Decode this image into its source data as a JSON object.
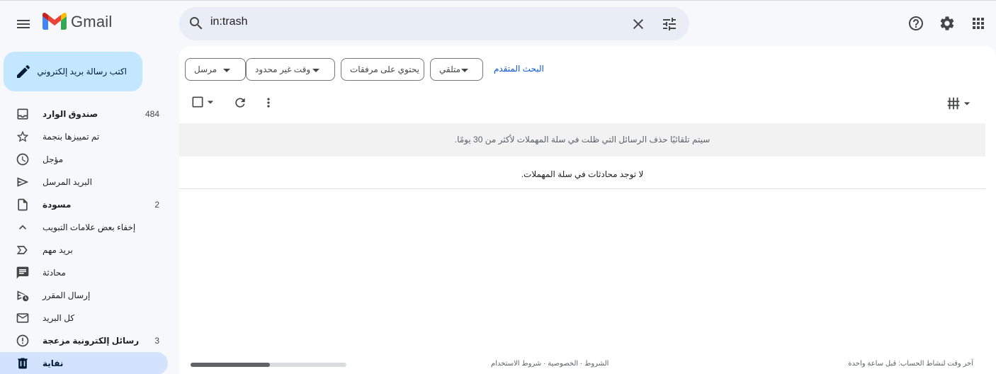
{
  "app": {
    "name": "Gmail"
  },
  "search": {
    "query": "in:trash"
  },
  "compose": {
    "label": "اكتب رسالة بريد إلكتروني"
  },
  "sidebar": {
    "items": [
      {
        "label": "صندوق الوارد",
        "count": "484",
        "icon": "inbox-icon"
      },
      {
        "label": "تم تمييزها بنجمة",
        "count": "",
        "icon": "star-icon"
      },
      {
        "label": "مؤجل",
        "count": "",
        "icon": "clock-icon"
      },
      {
        "label": "البريد المرسل",
        "count": "",
        "icon": "send-icon"
      },
      {
        "label": "مسودة",
        "count": "2",
        "icon": "draft-icon"
      },
      {
        "label": "إخفاء بعض علامات التبويب",
        "count": "",
        "icon": "chevron-up-icon"
      },
      {
        "label": "بريد مهم",
        "count": "",
        "icon": "important-icon"
      },
      {
        "label": "محادثة",
        "count": "",
        "icon": "chat-icon"
      },
      {
        "label": "إرسال المقرر",
        "count": "",
        "icon": "scheduled-icon"
      },
      {
        "label": "كل البريد",
        "count": "",
        "icon": "all-mail-icon"
      },
      {
        "label": "رسائل إلكترونية مزعجة",
        "count": "3",
        "icon": "spam-icon"
      },
      {
        "label": "نفاية",
        "count": "",
        "icon": "trash-icon"
      }
    ]
  },
  "filters": {
    "chips": [
      "مرسل",
      "وقت غير محدود",
      "يحتوي على مرفقات",
      "متلقي"
    ],
    "advanced": "البحث المتقدم"
  },
  "notice": "سيتم تلقائيًا حذف الرسائل التي ظلت في سلة المهملات لأكثر من 30 يومًا.",
  "empty_message": "لا توجد محادثات في سلة المهملات.",
  "footer": {
    "links": "الشروط · الخصوصية · شروط الاستخدام",
    "activity": "آخر وقت لنشاط الحساب: قبل ساعة واحدة"
  },
  "colors": {
    "accent": "#0b57d0",
    "compose_bg": "#c2e7ff",
    "active_nav": "#d3e3fd",
    "app_bg": "#f6f8fc"
  }
}
